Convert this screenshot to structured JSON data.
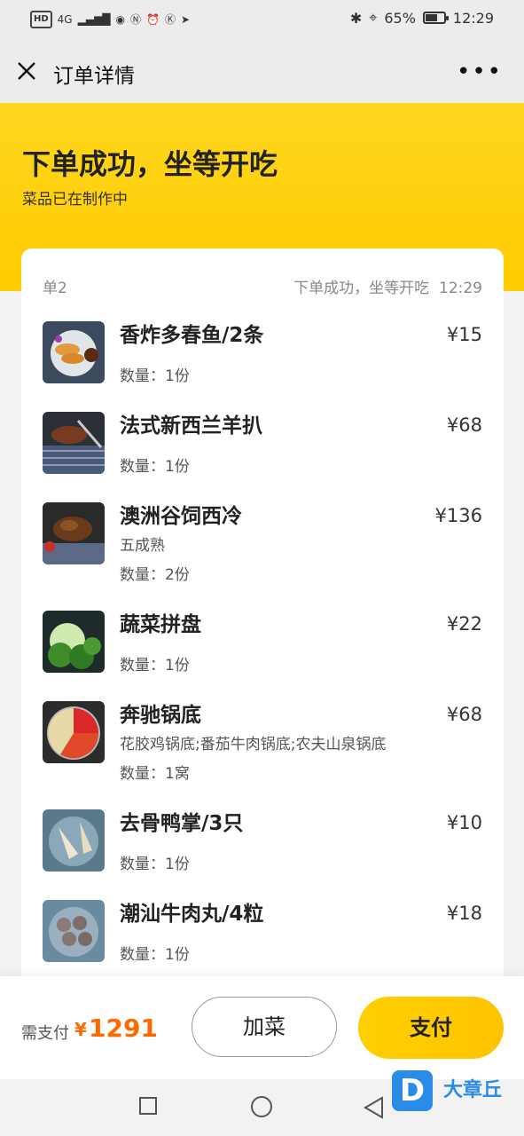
{
  "status_bar": {
    "left_chips": [
      "HD",
      "4G"
    ],
    "battery": "65%",
    "time": "12:29"
  },
  "nav": {
    "title": "订单详情"
  },
  "hero": {
    "title": "下单成功，坐等开吃",
    "subtitle": "菜品已在制作中"
  },
  "order": {
    "table_no": "单2",
    "status": "下单成功，坐等开吃",
    "time": "12:29",
    "items": [
      {
        "name": "香炸多春鱼/2条",
        "price": "¥15",
        "spec": "",
        "qty": "数量：1份"
      },
      {
        "name": "法式新西兰羊扒",
        "price": "¥68",
        "spec": "",
        "qty": "数量：1份"
      },
      {
        "name": "澳洲谷饲西冷",
        "price": "¥136",
        "spec": "五成熟",
        "qty": "数量：2份"
      },
      {
        "name": "蔬菜拼盘",
        "price": "¥22",
        "spec": "",
        "qty": "数量：1份"
      },
      {
        "name": "奔驰锅底",
        "price": "¥68",
        "spec": "花胶鸡锅底;番茄牛肉锅底;农夫山泉锅底",
        "qty": "数量：1窝"
      },
      {
        "name": "去骨鸭掌/3只",
        "price": "¥10",
        "spec": "",
        "qty": "数量：1份"
      },
      {
        "name": "潮汕牛肉丸/4粒",
        "price": "¥18",
        "spec": "",
        "qty": "数量：1份"
      }
    ]
  },
  "footer": {
    "pay_label": "需支付",
    "currency": "¥",
    "amount": "1291",
    "add_button": "加菜",
    "pay_button": "支付"
  },
  "watermark": {
    "text": "大章丘",
    "logo_letter": "D"
  },
  "colors": {
    "accent": "#ffcc00",
    "price": "#ff6a00"
  }
}
